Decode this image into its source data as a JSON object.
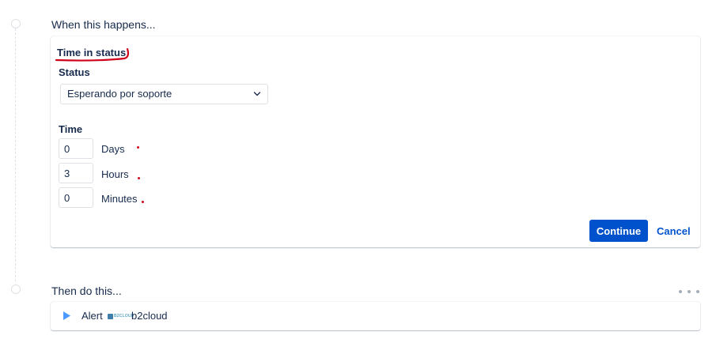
{
  "trigger": {
    "heading": "When this happens...",
    "title": "Time in status",
    "status_label": "Status",
    "status_value": "Esperando por soporte",
    "time_label": "Time",
    "fields": [
      {
        "value": "0",
        "unit": "Days"
      },
      {
        "value": "3",
        "unit": "Hours"
      },
      {
        "value": "0",
        "unit": "Minutes"
      }
    ],
    "continue_label": "Continue",
    "cancel_label": "Cancel"
  },
  "action": {
    "heading": "Then do this...",
    "label": "Alert",
    "logo_text": "B2CLOUD",
    "brand_name": "b2cloud"
  },
  "colors": {
    "primary": "#0052cc",
    "annotation_red": "#d0021b",
    "text": "#172b4d",
    "border": "#dfe1e6"
  }
}
